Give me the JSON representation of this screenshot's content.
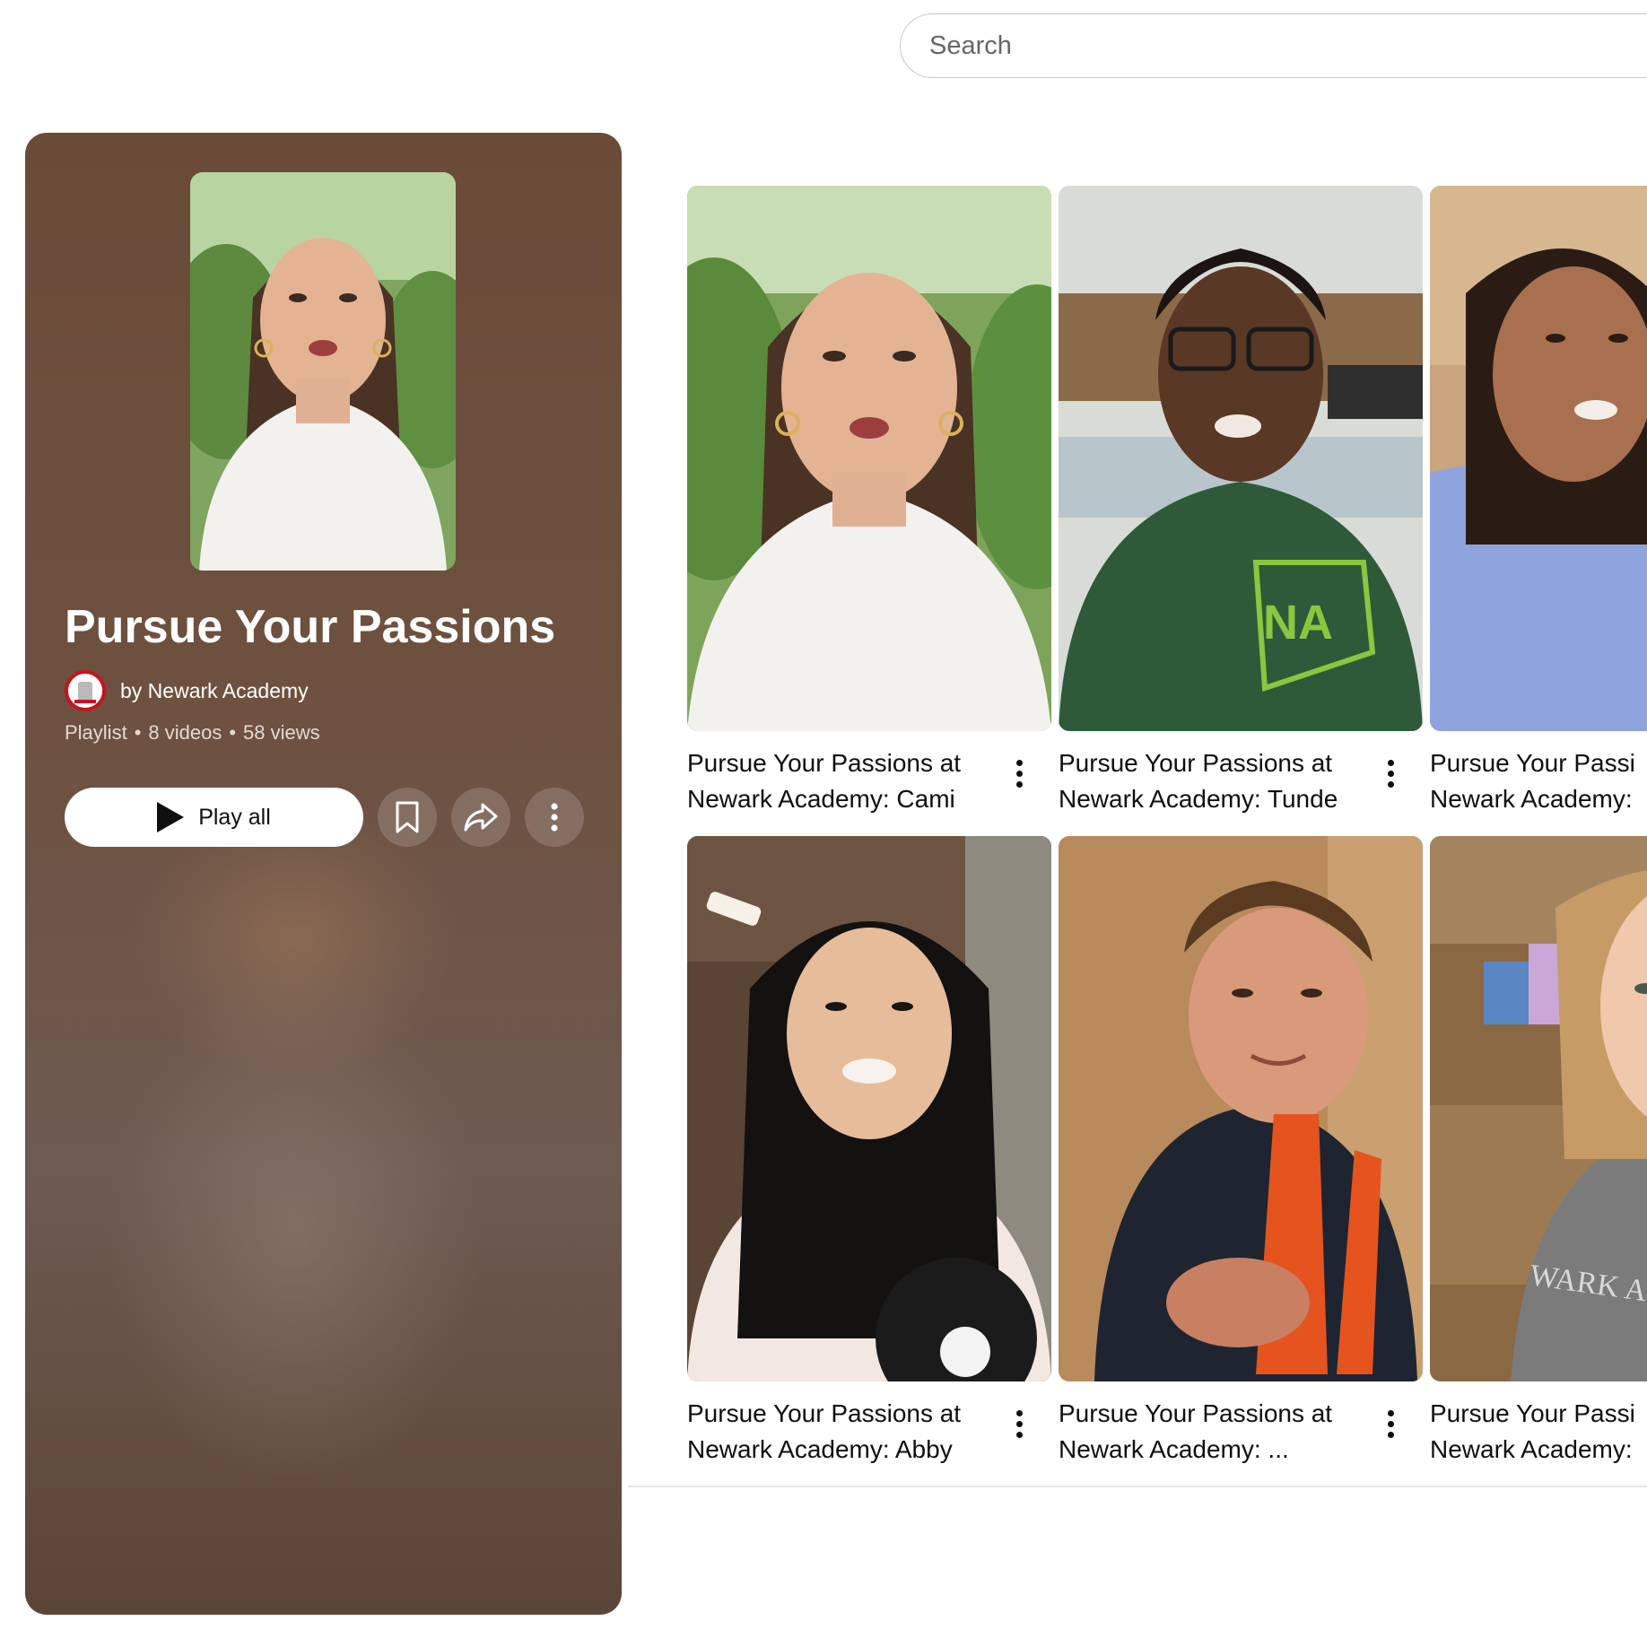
{
  "search": {
    "placeholder": "Search"
  },
  "playlist": {
    "title": "Pursue Your Passions",
    "owner": "by Newark Academy",
    "type": "Playlist",
    "video_count": "8 videos",
    "views": "58 views",
    "separator": "•",
    "play_all_label": "Play all",
    "icons": [
      "play-icon",
      "save-icon",
      "share-icon",
      "more-vert-icon"
    ]
  },
  "videos": [
    {
      "title_line1": "Pursue Your Passions at",
      "title_line2": "Newark Academy: Cami"
    },
    {
      "title_line1": "Pursue Your Passions at",
      "title_line2": "Newark Academy: Tunde"
    },
    {
      "title_line1": "Pursue Your Passi",
      "title_line2": "Newark Academy:"
    },
    {
      "title_line1": "Pursue Your Passions at",
      "title_line2": "Newark Academy: Abby"
    },
    {
      "title_line1": "Pursue Your Passions at",
      "title_line2": "Newark Academy: ..."
    },
    {
      "title_line1": "Pursue Your Passi",
      "title_line2": "Newark Academy:"
    }
  ],
  "colors": {
    "panel_brown": "#6a4b38",
    "text_primary": "#0f0f0f",
    "shirt_green": "#2e5a3a",
    "shirt_blue": "#8fa3dc",
    "school_red": "#c7141f"
  }
}
